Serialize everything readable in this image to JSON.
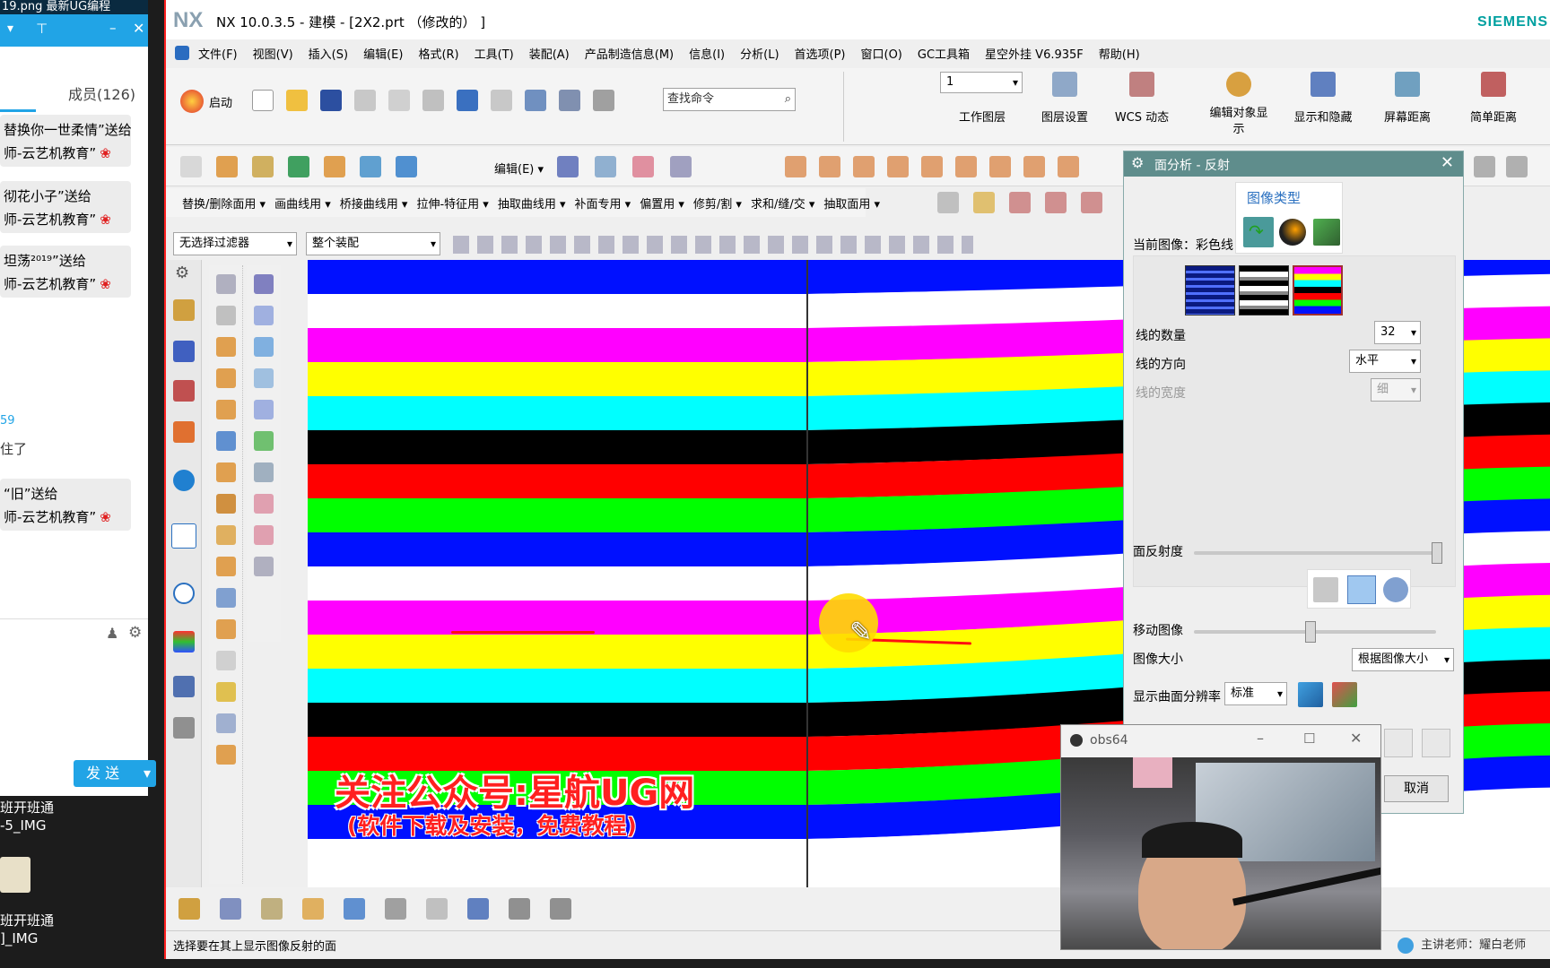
{
  "chat": {
    "titlebar": "19.png     最新UG编程",
    "members_label": "成员(126)",
    "messages": [
      {
        "line1": "替换你一世柔情”送给",
        "line2": "师-云艺机教育”"
      },
      {
        "line1": "彻花小子”送给",
        "line2": "师-云艺机教育”"
      },
      {
        "line1": "坦荡²⁰¹⁹”送给",
        "line2": "师-云艺机教育”"
      },
      {
        "line1": "59",
        "line2": "住了"
      },
      {
        "line1": "“旧”送给",
        "line2": "师-云艺机教育”"
      }
    ],
    "send_label": "发 送",
    "desktop_labels": [
      "班开班通",
      "-5_IMG",
      "班开班通",
      "]_IMG"
    ]
  },
  "nx": {
    "logo": "NX",
    "title": "NX 10.0.3.5 - 建模 - [2X2.prt （修改的） ]",
    "brand": "SIEMENS",
    "menu": [
      "文件(F)",
      "视图(V)",
      "插入(S)",
      "编辑(E)",
      "格式(R)",
      "工具(T)",
      "装配(A)",
      "产品制造信息(M)",
      "信息(I)",
      "分析(L)",
      "首选项(P)",
      "窗口(O)",
      "GC工具箱",
      "星空外挂 V6.935F",
      "帮助(H)"
    ],
    "start_label": "启动",
    "search_placeholder": "查找命令",
    "layer_value": "1",
    "right_tools": [
      "工作图层",
      "图层设置",
      "WCS 动态",
      "编辑对象显示",
      "显示和隐藏",
      "屏幕距离",
      "简单距离"
    ],
    "edit_label": "编辑(E)",
    "row3": [
      "替换/删除面用",
      "画曲线用",
      "桥接曲线用",
      "拉伸-特征用",
      "抽取曲线用",
      "补面专用",
      "偏置用",
      "修剪/割",
      "求和/缝/交",
      "抽取面用"
    ],
    "filter_value": "无选择过滤器",
    "assembly_value": "整个装配",
    "status": "选择要在其上显示图像反射的面"
  },
  "overlay": {
    "line1": "关注公众号:星航UG网",
    "line2": "(软件下载及安装，免费教程)",
    "teacher": "主讲老师：耀白老师"
  },
  "dialog": {
    "title": "面分析 - 反射",
    "image_type_label": "图像类型",
    "current_image_label": "当前图像：彩色线",
    "line_count_label": "线的数量",
    "line_count_value": "32",
    "line_dir_label": "线的方向",
    "line_dir_value": "水平",
    "line_width_label": "线的宽度",
    "line_width_value": "细",
    "reflectivity_label": "面反射度",
    "move_image_label": "移动图像",
    "image_size_label": "图像大小",
    "image_size_value": "根据图像大小",
    "resolution_label": "显示曲面分辨率",
    "resolution_value": "标准",
    "cancel_label": "取消"
  },
  "obs": {
    "title": "obs64"
  },
  "colors": {
    "stripes": [
      "#0010ff",
      "#ffffff",
      "#ff00ff",
      "#ffff00",
      "#00ffff",
      "#000000",
      "#ff0000",
      "#00ff00"
    ],
    "nx_accent": "#00a0a0",
    "dialog_header": "#5f8d8c"
  }
}
